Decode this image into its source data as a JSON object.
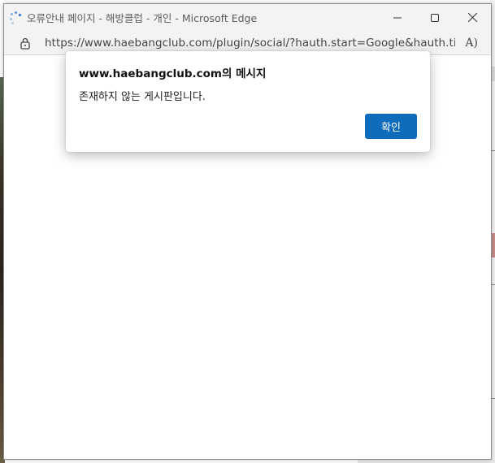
{
  "window": {
    "title": "오류안내 페이지 - 해방클럽 - 개인 - Microsoft Edge",
    "controls": {
      "minimize": "—",
      "maximize": "▢",
      "close": "✕"
    }
  },
  "addressbar": {
    "url": "https://www.haebangclub.com/plugin/social/?hauth.start=Google&hauth.time=...",
    "read_aloud_icon": "A)"
  },
  "dialog": {
    "title": "www.haebangclub.com의 메시지",
    "message": "존재하지 않는 게시판입니다.",
    "ok_label": "확인",
    "ok_color": "#0f6cbd"
  }
}
